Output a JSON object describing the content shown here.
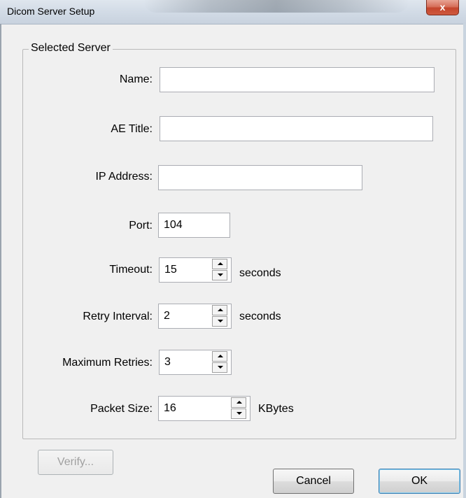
{
  "window": {
    "title": "Dicom Server Setup",
    "close_glyph": "x"
  },
  "groupbox": {
    "label": "Selected Server"
  },
  "fields": {
    "name": {
      "label": "Name:",
      "value": ""
    },
    "ae_title": {
      "label": "AE Title:",
      "value": ""
    },
    "ip_address": {
      "label": "IP Address:",
      "value": ""
    },
    "port": {
      "label": "Port:",
      "value": "104"
    },
    "timeout": {
      "label": "Timeout:",
      "value": "15",
      "unit": "seconds"
    },
    "retry_interval": {
      "label": "Retry Interval:",
      "value": "2",
      "unit": "seconds"
    },
    "maximum_retries": {
      "label": "Maximum Retries:",
      "value": "3"
    },
    "packet_size": {
      "label": "Packet Size:",
      "value": "16",
      "unit": "KBytes"
    }
  },
  "buttons": {
    "verify": "Verify...",
    "cancel": "Cancel",
    "ok": "OK"
  },
  "colors": {
    "close_button": "#c4452c",
    "titlebar": "#d2dbe6",
    "window_bg": "#f0f0f0"
  },
  "icons": {
    "close": "close-icon",
    "spin_up": "spin-up-icon",
    "spin_down": "spin-down-icon"
  }
}
